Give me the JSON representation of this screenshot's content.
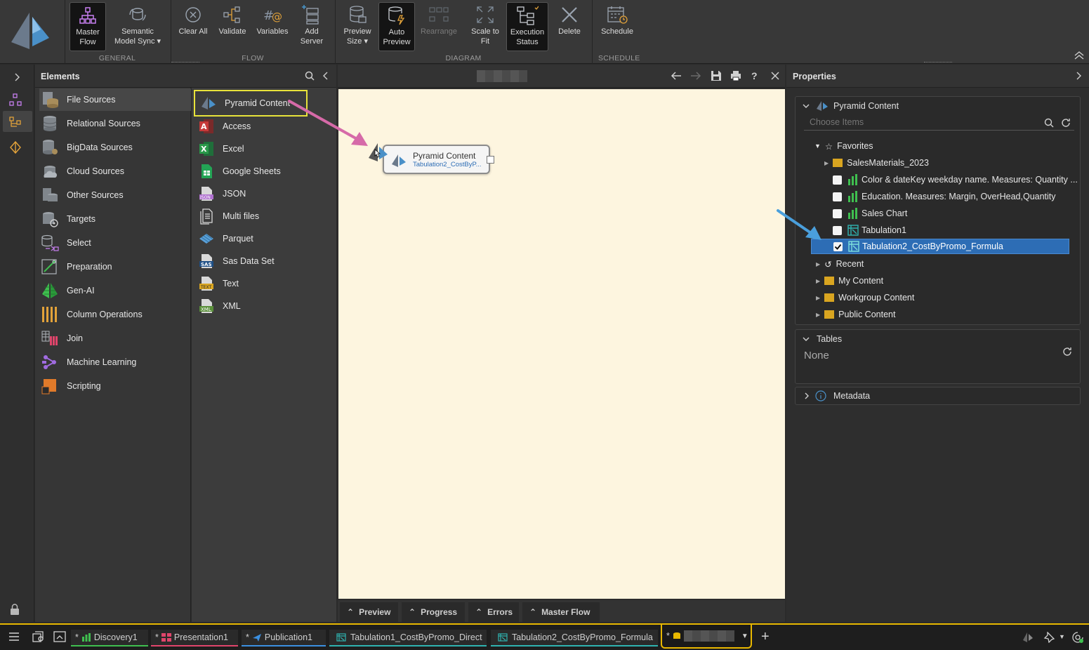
{
  "ribbon": {
    "buttons": [
      {
        "key": "master_flow",
        "label": "Master\nFlow",
        "icon": "master-flow-icon"
      },
      {
        "key": "semantic_model_sync",
        "label": "Semantic\nModel Sync ▾",
        "icon": "semantic-sync-icon"
      },
      {
        "key": "clear_all",
        "label": "Clear All",
        "icon": "clear-all-icon"
      },
      {
        "key": "validate",
        "label": "Validate",
        "icon": "validate-icon"
      },
      {
        "key": "variables",
        "label": "Variables",
        "icon": "variables-icon"
      },
      {
        "key": "add_server",
        "label": "Add\nServer",
        "icon": "add-server-icon"
      },
      {
        "key": "preview_size",
        "label": "Preview\nSize ▾",
        "icon": "preview-size-icon"
      },
      {
        "key": "auto_preview",
        "label": "Auto\nPreview",
        "icon": "auto-preview-icon"
      },
      {
        "key": "rearrange",
        "label": "Rearrange",
        "icon": "rearrange-icon"
      },
      {
        "key": "scale_to_fit",
        "label": "Scale to\nFit",
        "icon": "scale-to-fit-icon"
      },
      {
        "key": "execution_status",
        "label": "Execution\nStatus",
        "icon": "execution-status-icon"
      },
      {
        "key": "delete",
        "label": "Delete",
        "icon": "delete-icon"
      },
      {
        "key": "schedule",
        "label": "Schedule",
        "icon": "schedule-icon"
      }
    ],
    "groups": {
      "general": "GENERAL",
      "flow": "FLOW",
      "diagram": "DIAGRAM",
      "schedule": "SCHEDULE"
    }
  },
  "elements": {
    "title": "Elements",
    "categories": [
      {
        "label": "File Sources",
        "icon": "file-sources-icon"
      },
      {
        "label": "Relational Sources",
        "icon": "relational-sources-icon"
      },
      {
        "label": "BigData Sources",
        "icon": "bigdata-sources-icon"
      },
      {
        "label": "Cloud Sources",
        "icon": "cloud-sources-icon"
      },
      {
        "label": "Other Sources",
        "icon": "other-sources-icon"
      },
      {
        "label": "Targets",
        "icon": "targets-icon"
      },
      {
        "label": "Select",
        "icon": "select-icon"
      },
      {
        "label": "Preparation",
        "icon": "preparation-icon"
      },
      {
        "label": "Gen-AI",
        "icon": "gen-ai-icon"
      },
      {
        "label": "Column Operations",
        "icon": "column-operations-icon"
      },
      {
        "label": "Join",
        "icon": "join-icon"
      },
      {
        "label": "Machine Learning",
        "icon": "machine-learning-icon"
      },
      {
        "label": "Scripting",
        "icon": "scripting-icon"
      }
    ],
    "sources": [
      {
        "label": "Pyramid Content",
        "icon": "pyramid-icon"
      },
      {
        "label": "Access",
        "icon": "access-icon"
      },
      {
        "label": "Excel",
        "icon": "excel-icon"
      },
      {
        "label": "Google Sheets",
        "icon": "google-sheets-icon"
      },
      {
        "label": "JSON",
        "icon": "json-icon"
      },
      {
        "label": "Multi files",
        "icon": "multi-files-icon"
      },
      {
        "label": "Parquet",
        "icon": "parquet-icon"
      },
      {
        "label": "Sas Data Set",
        "icon": "sas-icon"
      },
      {
        "label": "Text",
        "icon": "text-file-icon"
      },
      {
        "label": "XML",
        "icon": "xml-icon"
      }
    ]
  },
  "canvas": {
    "node": {
      "title": "Pyramid Content",
      "subtitle": "Tabulation2_CostByP..."
    },
    "bottom_tabs": [
      "Preview",
      "Progress",
      "Errors",
      "Master Flow"
    ]
  },
  "properties": {
    "title": "Properties",
    "section_title": "Pyramid Content",
    "search_placeholder": "Choose Items",
    "tree": {
      "favorites": "Favorites",
      "folder": "SalesMaterials_2023",
      "items": [
        {
          "label": "Color & dateKey weekday name. Measures: Quantity ...",
          "checked": false,
          "icon": "bar-chart-icon"
        },
        {
          "label": "Education. Measures: Margin, OverHead,Quantity",
          "checked": false,
          "icon": "bar-chart-icon"
        },
        {
          "label": "Sales Chart",
          "checked": false,
          "icon": "bar-chart-icon"
        },
        {
          "label": "Tabulation1",
          "checked": false,
          "icon": "tabulation-icon"
        },
        {
          "label": "Tabulation2_CostByPromo_Formula",
          "checked": true,
          "icon": "tabulation-icon"
        }
      ],
      "others": [
        "Recent",
        "My Content",
        "Workgroup Content",
        "Public Content"
      ]
    },
    "tables_title": "Tables",
    "tables_value": "None",
    "metadata_title": "Metadata"
  },
  "taskbar": {
    "tabs": [
      {
        "label": "Discovery1",
        "prefix": "*",
        "color": "#3fbf4f"
      },
      {
        "label": "Presentation1",
        "prefix": "*",
        "color": "#e0456b"
      },
      {
        "label": "Publication1",
        "prefix": "*",
        "color": "#3b8fe0"
      },
      {
        "label": "Tabulation1_CostByPromo_Direct",
        "prefix": "",
        "color": "#2fb3b0"
      },
      {
        "label": "Tabulation2_CostByPromo_Formula",
        "prefix": "",
        "color": "#2fb3b0"
      },
      {
        "label": "",
        "prefix": "*",
        "color": "#e8b800"
      }
    ]
  },
  "colors": {
    "accent_yellow": "#e8b800",
    "selection_blue": "#2d6db5",
    "canvas_bg": "#fdf5df",
    "arrow_pink": "#d66aa8",
    "arrow_blue": "#4a9fdc"
  }
}
